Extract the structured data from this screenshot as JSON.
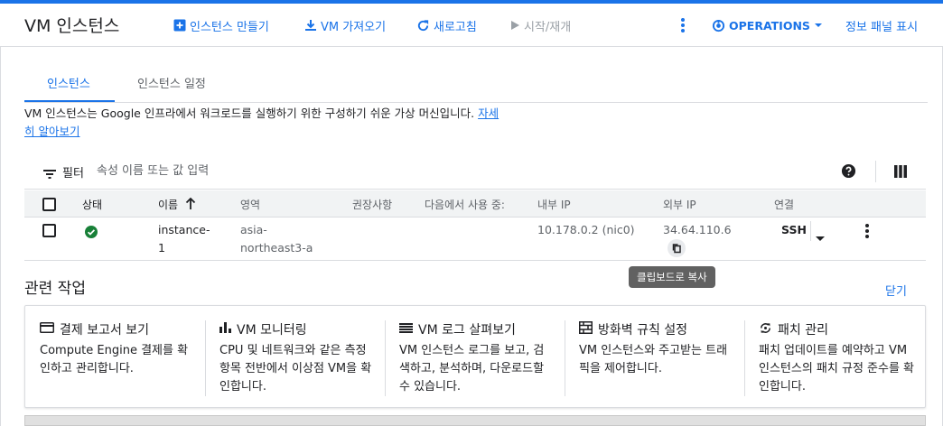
{
  "accent_color": "#1a73e8",
  "toolbar": {
    "title": "VM 인스턴스",
    "buttons": [
      {
        "label": "인스턴스 만들기",
        "icon": "add-box-icon"
      },
      {
        "label": "VM 가져오기",
        "icon": "download-icon"
      },
      {
        "label": "새로고침",
        "icon": "refresh-icon"
      },
      {
        "label": "시작/재개",
        "icon": "play-icon",
        "disabled": true
      }
    ],
    "more_icon": "more-vert-icon",
    "operations_label": "OPERATIONS",
    "info_panel_label": "정보 패널 표시"
  },
  "tabs": [
    {
      "label": "인스턴스",
      "active": true
    },
    {
      "label": "인스턴스 일정",
      "active": false
    }
  ],
  "description": {
    "text": "VM 인스턴스는 Google 인프라에서 워크로드를 실행하기 위한 구성하기 쉬운 가상 머신입니다.",
    "link": "자세히 알아보기"
  },
  "filter": {
    "label": "필터",
    "placeholder": "속성 이름 또는 값 입력"
  },
  "table": {
    "columns": [
      "상태",
      "이름",
      "영역",
      "권장사항",
      "다음에서 사용 중:",
      "내부 IP",
      "외부 IP",
      "연결"
    ],
    "rows": [
      {
        "status": "running",
        "name_line1": "instance-",
        "name_line2": "1",
        "zone_line1": "asia-",
        "zone_line2": "northeast3-a",
        "recommendation": "",
        "in_use_by": "",
        "internal_ip": "10.178.0.2 (nic0)",
        "external_ip": "34.64.110.6",
        "connect": "SSH"
      }
    ]
  },
  "tooltip": "클립보드로 복사",
  "related": {
    "title": "관련 작업",
    "close_label": "닫기",
    "cards": [
      {
        "icon": "billing-icon",
        "title": "결제 보고서 보기",
        "desc": "Compute Engine 결제를 확인하고 관리합니다."
      },
      {
        "icon": "monitoring-icon",
        "title": "VM 모니터링",
        "desc": "CPU 및 네트워크와 같은 측정항목 전반에서 이상점 VM을 확인합니다."
      },
      {
        "icon": "logs-icon",
        "title": "VM 로그 살펴보기",
        "desc": "VM 인스턴스 로그를 보고, 검색하고, 분석하며, 다운로드할 수 있습니다."
      },
      {
        "icon": "firewall-icon",
        "title": "방화벽 규칙 설정",
        "desc": "VM 인스턴스와 주고받는 트래픽을 제어합니다."
      },
      {
        "icon": "patch-icon",
        "title": "패치 관리",
        "desc": "패치 업데이트를 예약하고 VM 인스턴스의 패치 규정 준수를 확인합니다."
      }
    ]
  }
}
